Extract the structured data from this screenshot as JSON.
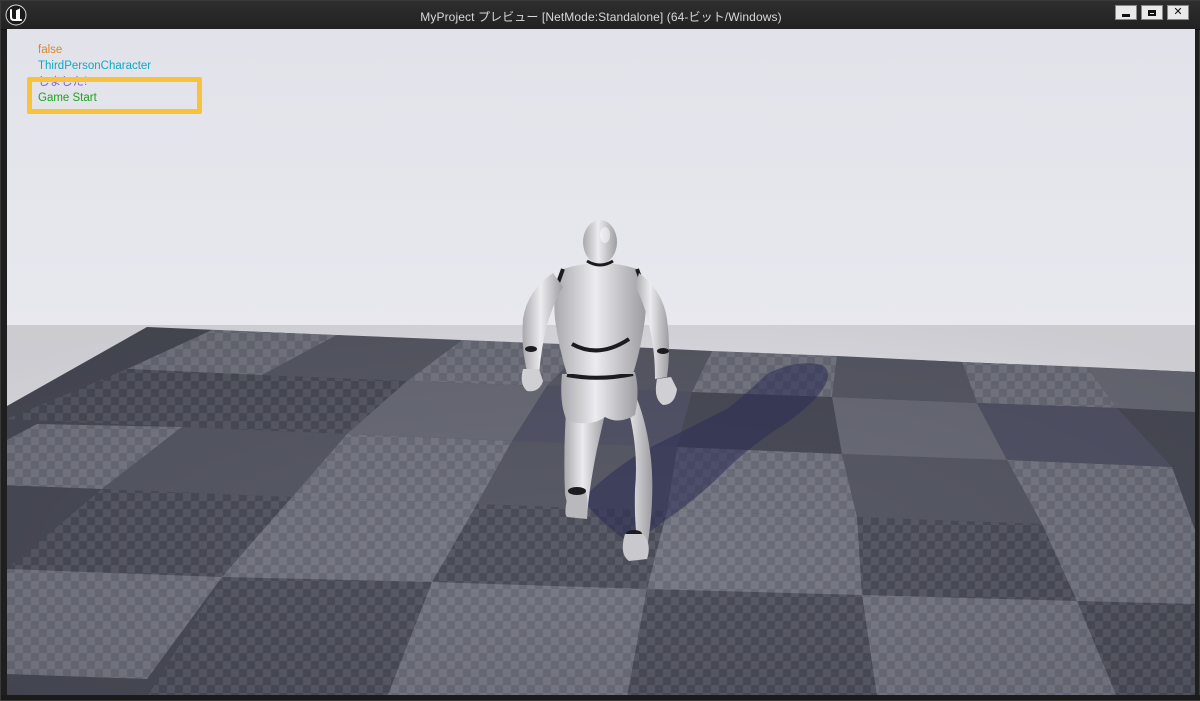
{
  "window": {
    "title": "MyProject プレビュー [NetMode:Standalone]  (64-ビット/Windows)",
    "app_icon": "unreal-engine-logo",
    "controls": {
      "minimize_icon": "minimize-icon",
      "maximize_icon": "maximize-icon",
      "close_icon": "close-icon",
      "close_glyph": "✕"
    }
  },
  "viewport": {
    "sky_color": "#e8e8ef",
    "floor_dark": "#4a4c58",
    "floor_light": "#6b6d79",
    "character": "mannequin-third-person"
  },
  "debug_log": {
    "lines": [
      {
        "text": "false",
        "color": "#d7882a"
      },
      {
        "text": "ThirdPersonCharacter",
        "color": "#0fa9c4"
      },
      {
        "text": "しました!",
        "color": "#8a5ed2"
      },
      {
        "text": "Game Start",
        "color": "#19a51a"
      }
    ]
  },
  "annotation": {
    "highlight_color": "#f7c33a"
  }
}
